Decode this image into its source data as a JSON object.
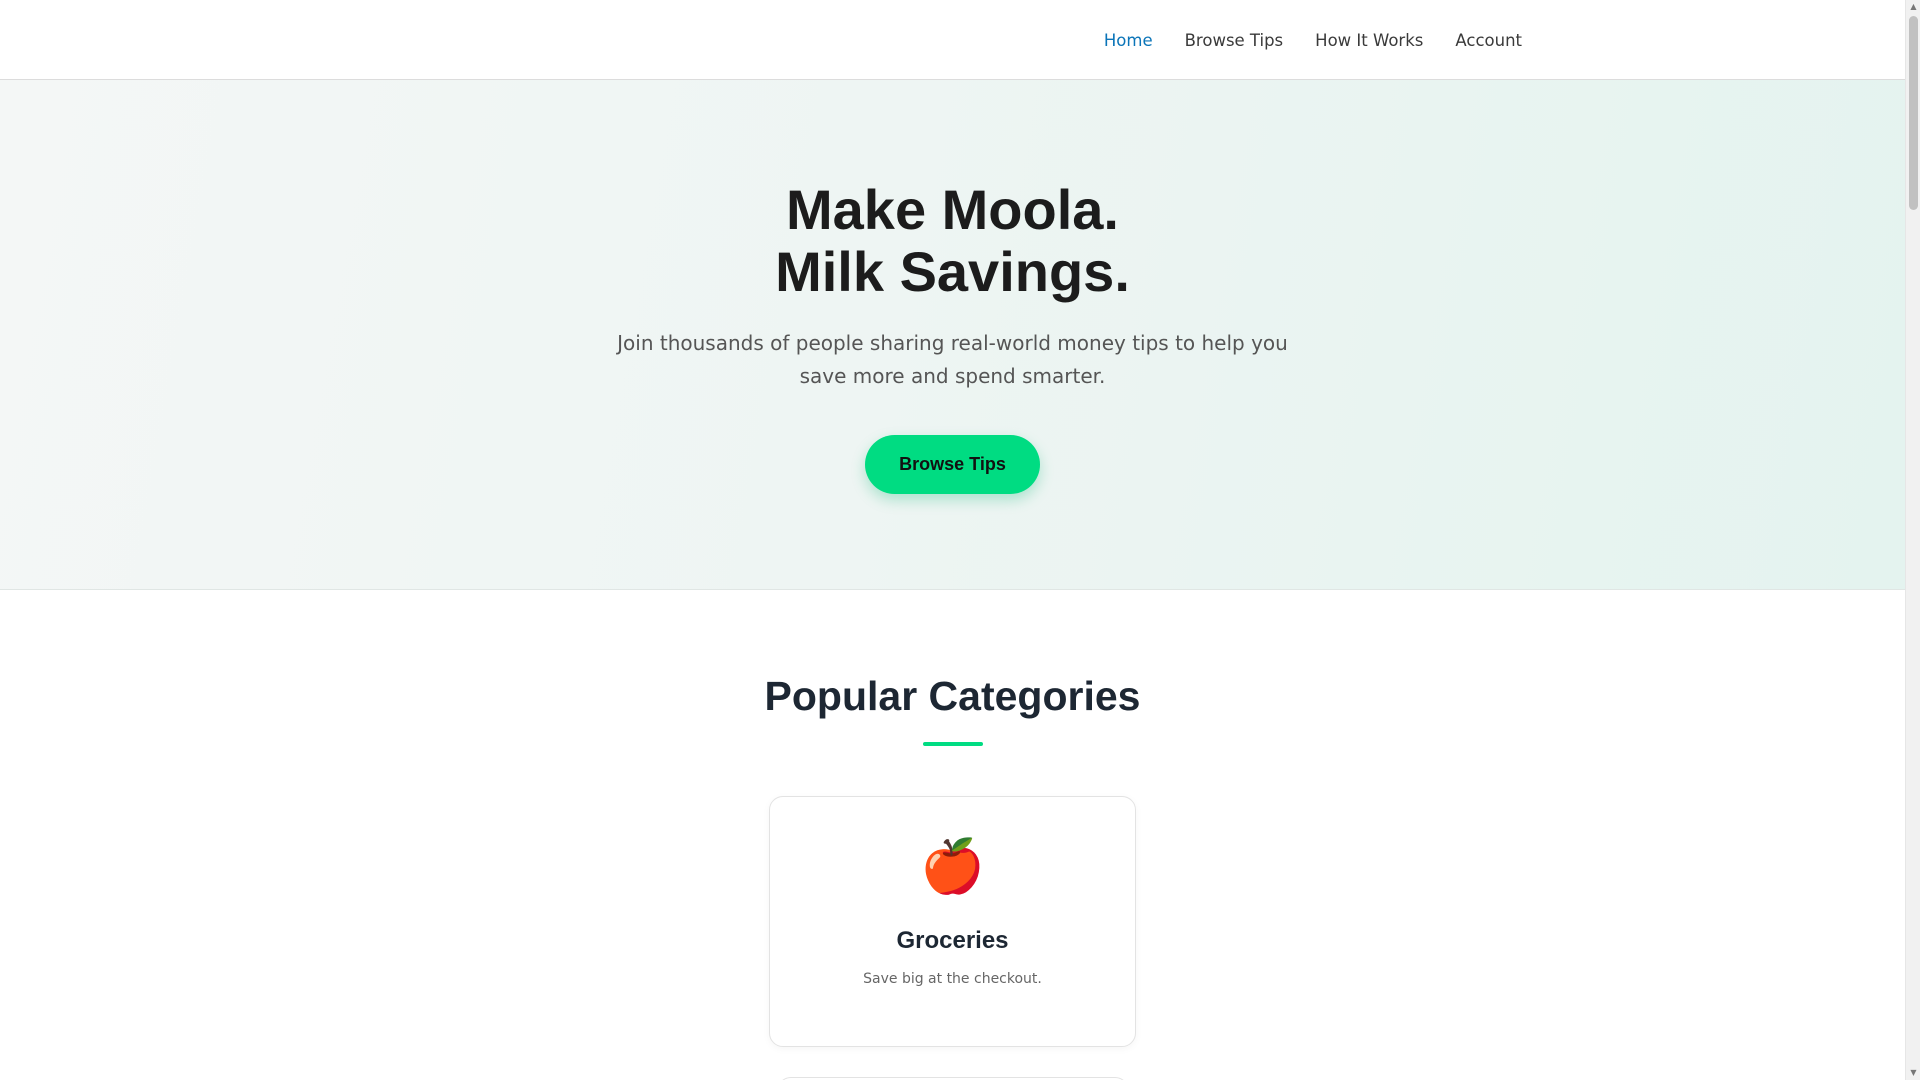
{
  "nav": {
    "items": [
      {
        "label": "Home",
        "active": true
      },
      {
        "label": "Browse Tips",
        "active": false
      },
      {
        "label": "How It Works",
        "active": false
      },
      {
        "label": "Account",
        "active": false
      }
    ]
  },
  "hero": {
    "title_line1": "Make Moola.",
    "title_line2": "Milk Savings.",
    "subtitle": "Join thousands of people sharing real-world money tips to help you save more and spend smarter.",
    "cta_label": "Browse Tips"
  },
  "categories": {
    "heading": "Popular Categories",
    "items": [
      {
        "icon": "apple-icon",
        "emoji": "🍎",
        "title": "Groceries",
        "description": "Save big at the checkout."
      }
    ]
  },
  "colors": {
    "accent": "#00dc82",
    "active_nav": "#0a74b8",
    "heading": "#1d2733"
  }
}
